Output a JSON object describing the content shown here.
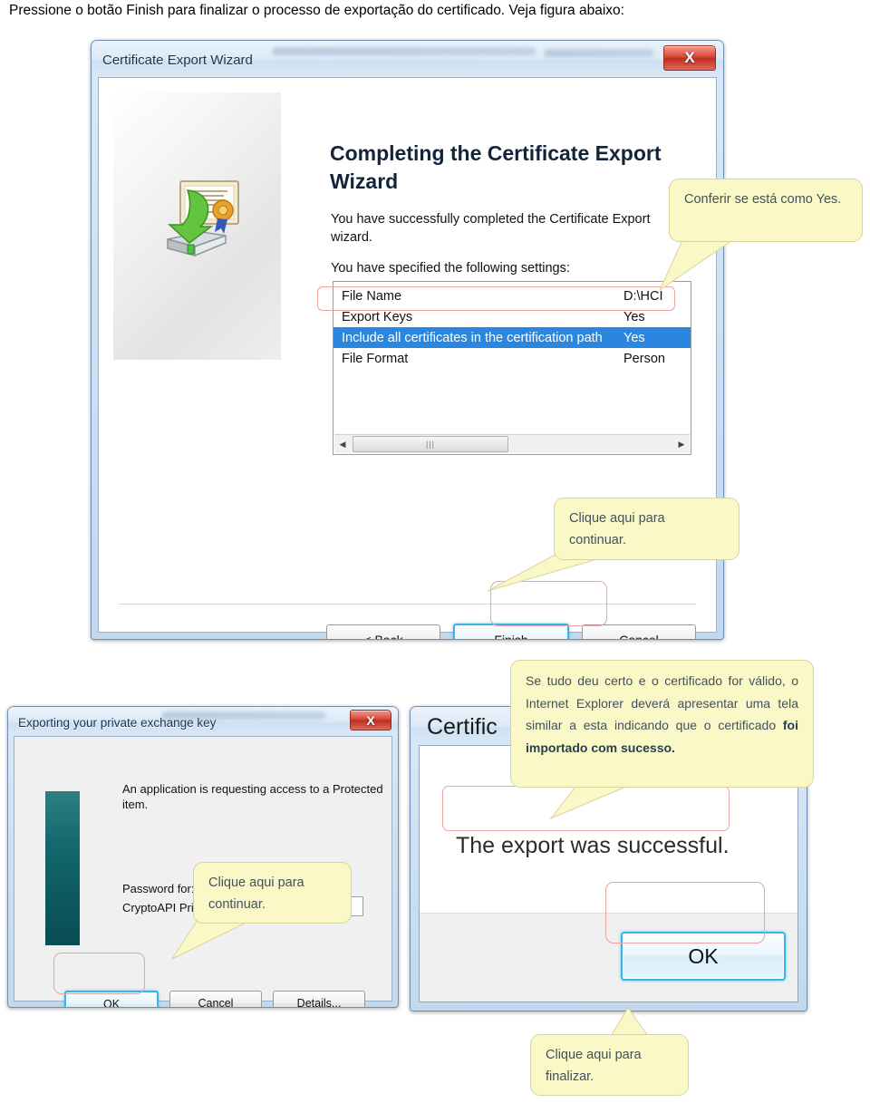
{
  "intro": {
    "text": "Pressione o botão Finish para finalizar o processo de exportação do certificado. Veja figura abaixo:"
  },
  "wizard": {
    "title": "Certificate Export Wizard",
    "close_label": "X",
    "heading": "Completing the Certificate Export Wizard",
    "paragraph1": "You have successfully completed the Certificate Export wizard.",
    "paragraph2": "You have specified the following settings:",
    "settings": [
      {
        "label": "File Name",
        "value": "D:\\HCI",
        "selected": false
      },
      {
        "label": "Export Keys",
        "value": "Yes",
        "selected": false
      },
      {
        "label": "Include all certificates in the certification path",
        "value": "Yes",
        "selected": true
      },
      {
        "label": "File Format",
        "value": "Person",
        "selected": false
      }
    ],
    "scrollbar": {
      "left_arrow": "◀",
      "right_arrow": "▶",
      "thumb_grip": "|||"
    },
    "buttons": {
      "back": "< Back",
      "finish": "Finish",
      "cancel": "Cancel"
    }
  },
  "callouts": {
    "check_yes": "Conferir se está como Yes.",
    "click_continue_wizard": "Clique aqui para continuar.",
    "click_continue_key": "Clique aqui para continuar.",
    "success_note_part1": "Se tudo deu certo e o certificado for válido, o Internet Explorer deverá apresentar uma tela similar a esta indicando que o certificado ",
    "success_note_bold": "foi importado com sucesso.",
    "click_finish": "Clique aqui para finalizar."
  },
  "key_dialog": {
    "title": "Exporting your private exchange key",
    "close_label": "X",
    "message": "An application is requesting access to a Protected item.",
    "password_label": "Password for:",
    "password_sub": "CryptoAPI Private Key",
    "password_value": "",
    "buttons": {
      "ok": "OK",
      "cancel": "Cancel",
      "details": "Details..."
    }
  },
  "success_dialog": {
    "title": "Certific",
    "message": "The export was successful.",
    "button_ok": "OK"
  },
  "colors": {
    "callout_bg": "#fbf8c8",
    "callout_border": "#d8d49a",
    "highlight_red": "#e9a3a3",
    "selection_blue": "#2a86de",
    "focus_blue": "#35b5ea",
    "close_red": "#bd2e22"
  }
}
